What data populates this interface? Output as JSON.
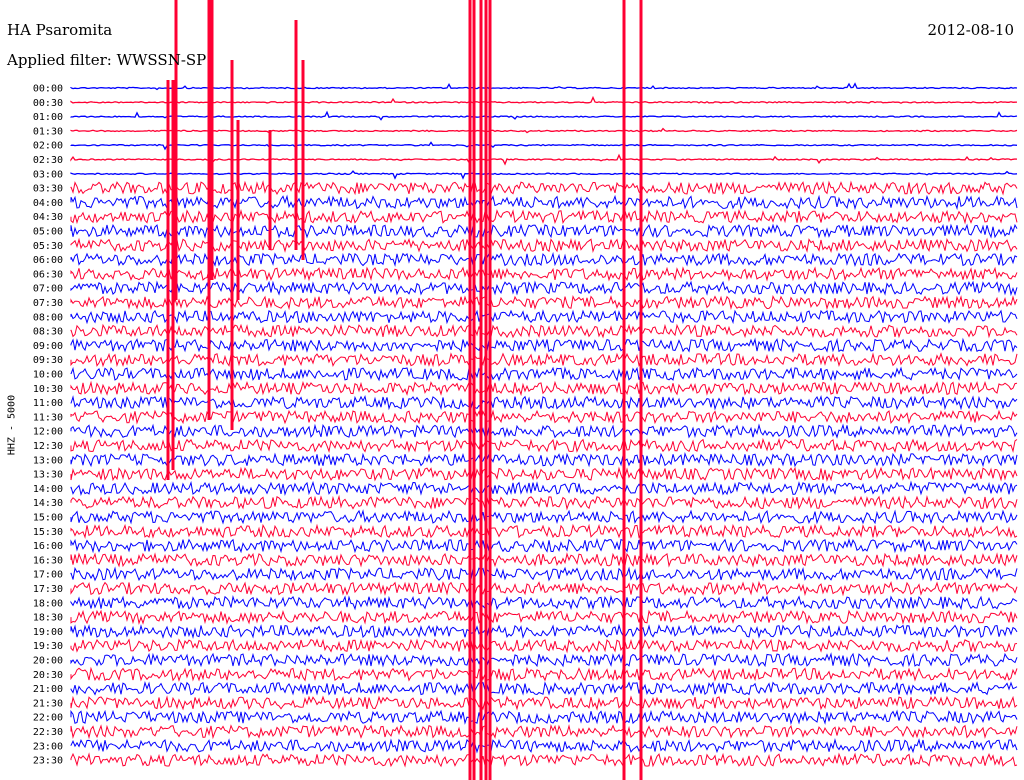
{
  "header": {
    "station": "HA Psaromita",
    "date": "2012-08-10",
    "filter": "Applied filter: WWSSN-SP"
  },
  "chart_data": {
    "type": "line",
    "title": "HA Psaromita",
    "ylabel": "HHZ - 5000",
    "row_labels": [
      "00:00",
      "00:30",
      "01:00",
      "01:30",
      "02:00",
      "02:30",
      "03:00",
      "03:30",
      "04:00",
      "04:30",
      "05:00",
      "05:30",
      "06:00",
      "06:30",
      "07:00",
      "07:30",
      "08:00",
      "08:30",
      "09:00",
      "09:30",
      "10:00",
      "10:30",
      "11:00",
      "11:30",
      "12:00",
      "12:30",
      "13:00",
      "13:30",
      "14:00",
      "14:30",
      "15:00",
      "15:30",
      "16:00",
      "16:30",
      "17:00",
      "17:30",
      "18:00",
      "18:30",
      "19:00",
      "19:30",
      "20:00",
      "20:30",
      "21:00",
      "21:30",
      "22:00",
      "22:30",
      "23:00",
      "23:30"
    ],
    "series_colors": [
      "#0000ff",
      "#ff0033"
    ],
    "quiet_rows": 7,
    "noise_amplitude": {
      "quiet": 0.6,
      "noisy": 6
    },
    "grid": false
  },
  "colors": {
    "blue": "#0000ff",
    "red": "#ff0033",
    "background": "#ffffff"
  }
}
